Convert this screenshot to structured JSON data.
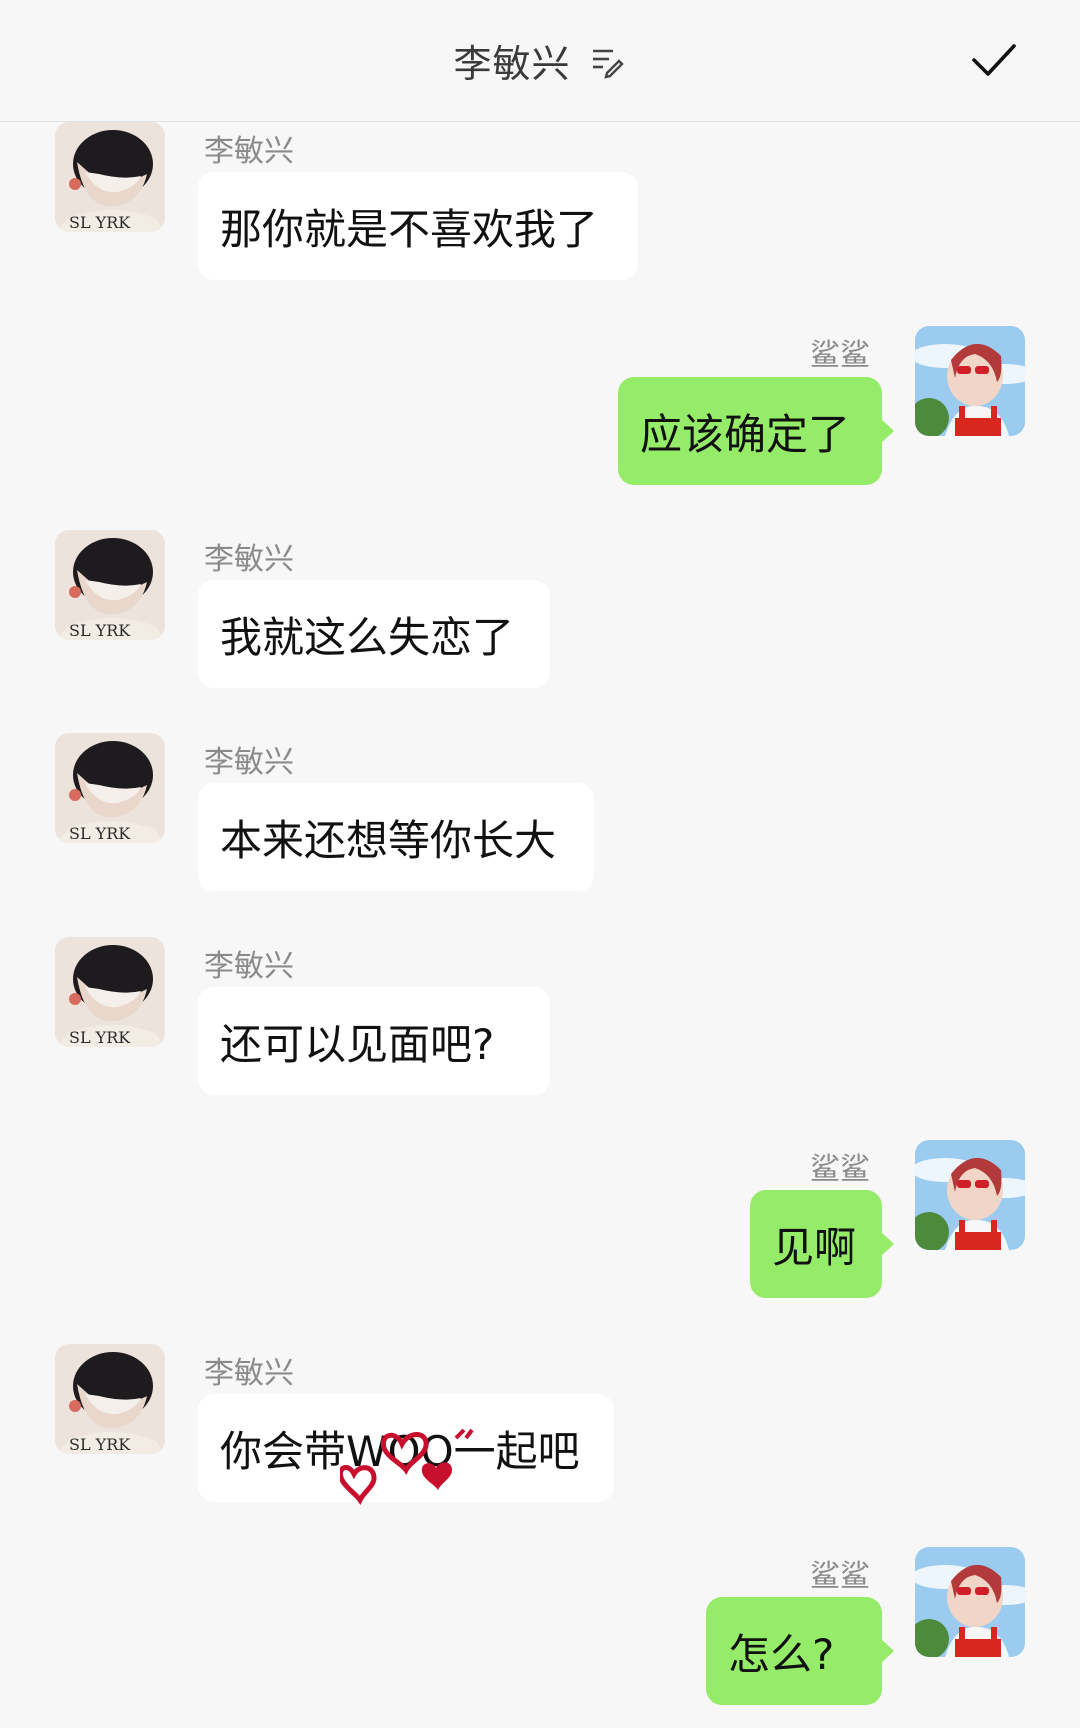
{
  "header": {
    "title": "李敏兴",
    "edit_icon": "edit-notes-icon",
    "confirm_icon": "checkmark-icon"
  },
  "colors": {
    "background": "#f7f7f7",
    "bubble_self": "#95ec69",
    "bubble_other": "#ffffff",
    "name_text": "#8a8a8a"
  },
  "messages": [
    {
      "sender": "李敏兴",
      "side": "left",
      "text": "那你就是不喜欢我了"
    },
    {
      "sender": "鲨鲨",
      "side": "right",
      "text": "应该确定了"
    },
    {
      "sender": "李敏兴",
      "side": "left",
      "text": "我就这么失恋了"
    },
    {
      "sender": "李敏兴",
      "side": "left",
      "text": "本来还想等你长大"
    },
    {
      "sender": "李敏兴",
      "side": "left",
      "text": "还可以见面吧?"
    },
    {
      "sender": "鲨鲨",
      "side": "right",
      "text": "见啊"
    },
    {
      "sender": "李敏兴",
      "side": "left",
      "text": "你会带WOQ一起吧",
      "decoration": "red-hearts-sticker"
    },
    {
      "sender": "鲨鲨",
      "side": "right",
      "text": "怎么?"
    }
  ]
}
